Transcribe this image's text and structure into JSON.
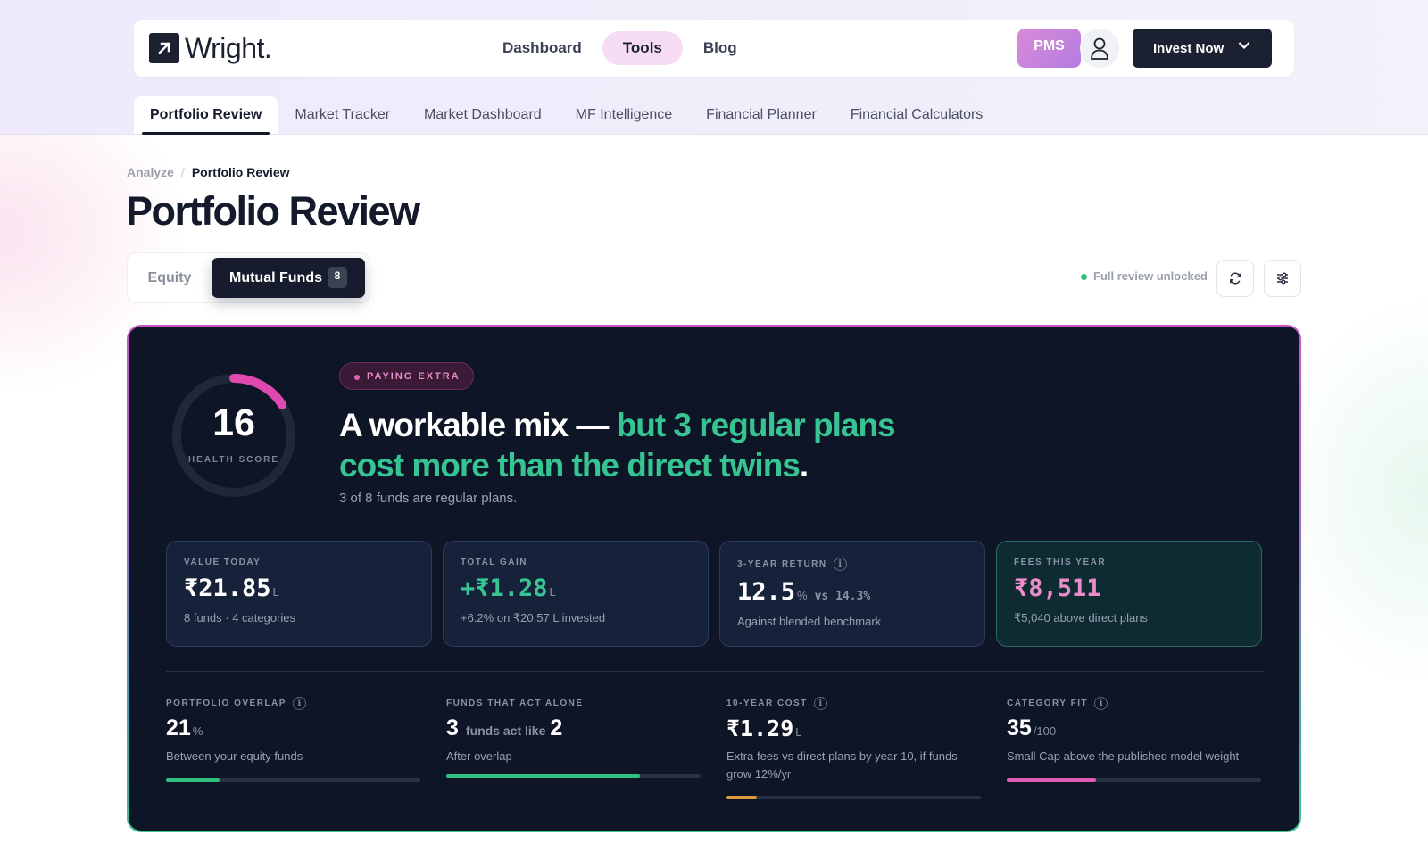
{
  "header": {
    "logo_text": "Wright.",
    "nav": [
      "Dashboard",
      "Tools",
      "Blog"
    ],
    "nav_active": "Tools",
    "pms_label": "PMS",
    "invest_label": "Invest Now"
  },
  "subnav": {
    "tabs": [
      "Portfolio Review",
      "Market Tracker",
      "Market Dashboard",
      "MF Intelligence",
      "Financial Planner",
      "Financial Calculators"
    ],
    "active": "Portfolio Review"
  },
  "breadcrumb": {
    "parent": "Analyze",
    "separator": "/",
    "current": "Portfolio Review"
  },
  "page_title": "Portfolio Review",
  "segment": {
    "equity_label": "Equity",
    "mf_label": "Mutual Funds",
    "mf_count": "8"
  },
  "status": {
    "unlock_text": "Full review unlocked"
  },
  "review": {
    "health_score": "16",
    "health_label": "HEALTH SCORE",
    "health_fraction": 0.16,
    "pill": "PAYING EXTRA",
    "headline_white": "A workable mix —",
    "headline_green": "but 3 regular plans cost more than the direct twins",
    "headline_end": ".",
    "subline": "3 of 8 funds are regular plans."
  },
  "stats": {
    "value_today": {
      "label": "VALUE TODAY",
      "value": "₹21.85",
      "unit": "L",
      "sub": "8 funds · 4 categories"
    },
    "total_gain": {
      "label": "TOTAL GAIN",
      "value": "+₹1.28",
      "unit": "L",
      "sub": "+6.2% on ₹20.57 L invested"
    },
    "three_year": {
      "label": "3-YEAR RETURN",
      "value": "12.5",
      "unit": "%",
      "vs": "vs 14.3%",
      "sub": "Against blended benchmark"
    },
    "fees": {
      "label": "FEES THIS YEAR",
      "value": "₹8,511",
      "sub": "₹5,040 above direct plans"
    }
  },
  "metrics": {
    "overlap": {
      "label": "PORTFOLIO OVERLAP",
      "value": "21",
      "unit": "%",
      "sub": "Between your equity funds",
      "progress": 0.21
    },
    "alone": {
      "label": "FUNDS THAT ACT ALONE",
      "value_a": "3",
      "mid": "funds act like",
      "value_b": "2",
      "sub": "After overlap",
      "progress": 0.76
    },
    "cost": {
      "label": "10-YEAR COST",
      "value": "₹1.29",
      "unit": "L",
      "sub": "Extra fees vs direct plans by year 10, if funds grow 12%/yr",
      "progress": 0.12
    },
    "fit": {
      "label": "CATEGORY FIT",
      "value": "35",
      "unit": "/100",
      "sub": "Small Cap above the published model weight",
      "progress": 0.35
    }
  },
  "colors": {
    "accent_green": "#36c592",
    "accent_pink": "#e05bb4",
    "cost_orange": "#d99a3a",
    "card_bg": "#0d1526"
  }
}
